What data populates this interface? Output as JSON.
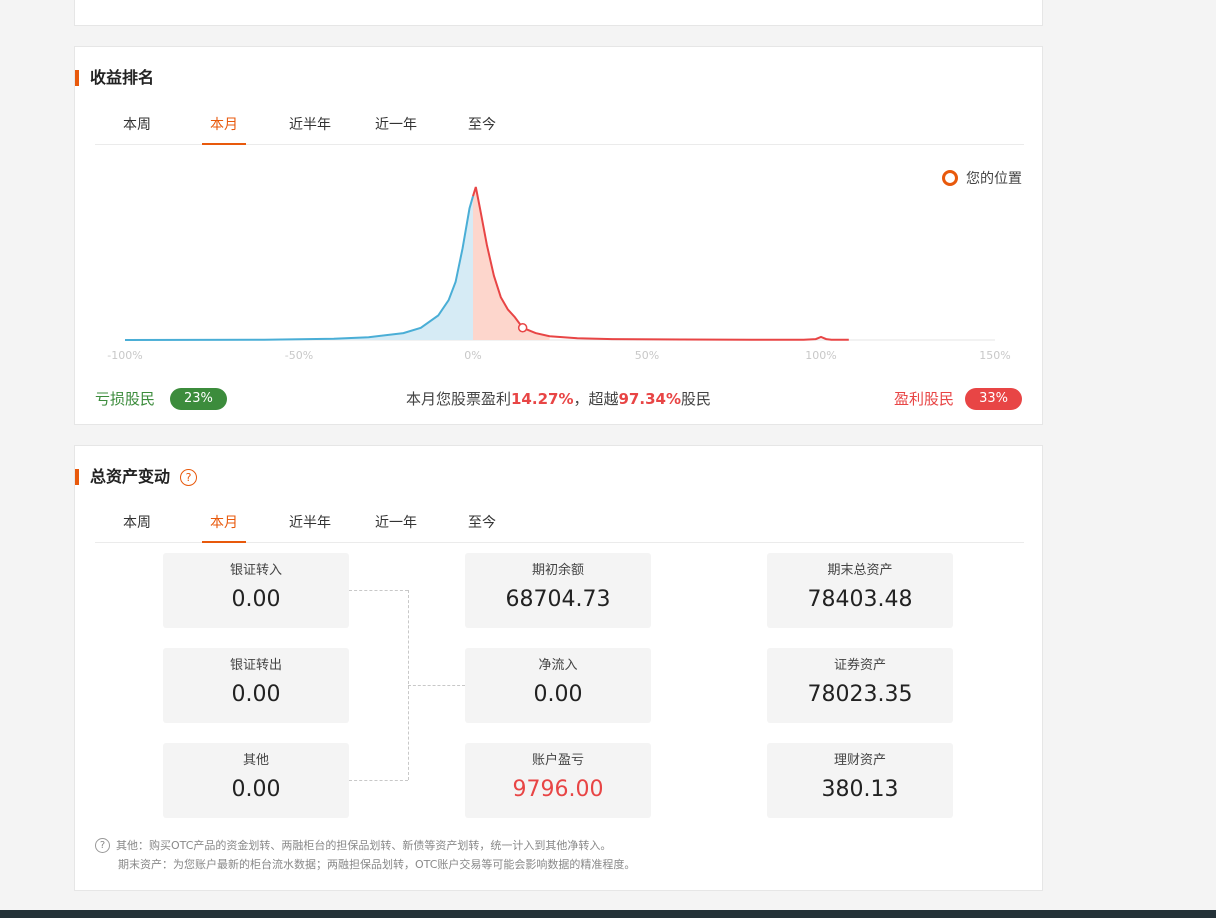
{
  "rank_section": {
    "title": "收益排名",
    "tabs": [
      "本周",
      "本月",
      "近半年",
      "近一年",
      "至今"
    ],
    "active_tab": "本月",
    "legend_label": "您的位置",
    "loss_label": "亏损股民",
    "loss_pct": "23%",
    "gain_label": "盈利股民",
    "gain_pct": "33%",
    "summary_pre": "本月您股票盈利",
    "summary_profit": "14.27%",
    "summary_mid": "，超越",
    "summary_beat": "97.34%",
    "summary_post": "股民",
    "colors": {
      "accent": "#e8590c",
      "loss": "#3c8c3c",
      "gain": "#e84545",
      "loss_fill": "#d6ebf5",
      "loss_line": "#4aaed6",
      "gain_fill": "#fdd6cc"
    }
  },
  "chart_data": {
    "type": "area",
    "x_ticks": [
      "-100%",
      "-50%",
      "0%",
      "50%",
      "100%",
      "150%"
    ],
    "x_tick_values": [
      -100,
      -50,
      0,
      50,
      100,
      150
    ],
    "xlim": [
      -100,
      150
    ],
    "ylim": [
      0,
      1
    ],
    "your_position_x": 14.27,
    "series": [
      {
        "segment": "loss",
        "x": [
          -100,
          -60,
          -40,
          -30,
          -20,
          -15,
          -10,
          -7,
          -5,
          -3,
          -1,
          0
        ],
        "y": [
          0,
          0.002,
          0.008,
          0.018,
          0.045,
          0.08,
          0.16,
          0.26,
          0.38,
          0.6,
          0.86,
          0.94
        ]
      },
      {
        "segment": "gain",
        "x": [
          0,
          0.8,
          2,
          4,
          6,
          8,
          10,
          12,
          14.27,
          18,
          22,
          30,
          40,
          60,
          80,
          95,
          98.5,
          100,
          101.5,
          103,
          108
        ],
        "y": [
          0.94,
          1.0,
          0.86,
          0.62,
          0.42,
          0.28,
          0.2,
          0.15,
          0.08,
          0.045,
          0.025,
          0.012,
          0.006,
          0.003,
          0.002,
          0.002,
          0.006,
          0.02,
          0.006,
          0.002,
          0.002
        ]
      }
    ]
  },
  "assets_section": {
    "title": "总资产变动",
    "tabs": [
      "本周",
      "本月",
      "近半年",
      "近一年",
      "至今"
    ],
    "active_tab": "本月",
    "col1": [
      {
        "label": "银证转入",
        "value": "0.00"
      },
      {
        "label": "银证转出",
        "value": "0.00"
      },
      {
        "label": "其他",
        "value": "0.00"
      }
    ],
    "col2": [
      {
        "label": "期初余额",
        "value": "68704.73"
      },
      {
        "label": "净流入",
        "value": "0.00"
      },
      {
        "label": "账户盈亏",
        "value": "9796.00"
      }
    ],
    "col3": [
      {
        "label": "期末总资产",
        "value": "78403.48"
      },
      {
        "label": "证券资产",
        "value": "78023.35"
      },
      {
        "label": "理财资产",
        "value": "380.13"
      }
    ],
    "note1": "其他：购买OTC产品的资金划转、两融柜台的担保品划转、新债等资产划转，统一计入到其他净转入。",
    "note2": "期末资产：为您账户最新的柜台流水数据；两融担保品划转，OTC账户交易等可能会影响数据的精准程度。"
  }
}
